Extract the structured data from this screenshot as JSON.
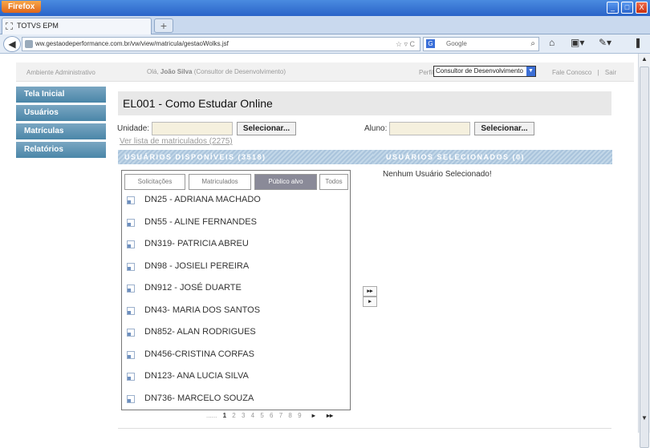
{
  "browser": {
    "menu_button": "Firefox",
    "tab_title": "TOTVS EPM",
    "new_tab": "+",
    "url": "ww.gestaodeperformance.com.br/vw/view/matricula/gestaoWolks.jsf",
    "search_engine": "G",
    "search_placeholder": "Google",
    "window_controls": [
      "_",
      "□",
      "X"
    ]
  },
  "header": {
    "environment": "Ambiente Administrativo",
    "greeting_prefix": "Olá, ",
    "user_name": "João Silva",
    "user_role": " (Consultor de Desenvolvimento)",
    "profile_label": "Perfil",
    "profile_value": "Consultor de Desenvolvimento",
    "contact_link": "Fale Conosco",
    "separator": "|",
    "exit_link": "Sair"
  },
  "sidebar": {
    "items": [
      {
        "label": "Tela Inicial"
      },
      {
        "label": "Usuários"
      },
      {
        "label": "Matrículas"
      },
      {
        "label": "Relatórios"
      }
    ]
  },
  "main": {
    "title": "EL001 - Como Estudar Online",
    "unit_label": "Unidade:",
    "unit_value": "",
    "select_button": "Selecionar...",
    "student_label": "Aluno:",
    "student_value": "",
    "enrollment_link": "Ver lista de matriculados (2275)",
    "available_header": "USUÁRIOS DISPONÍVEIS (3518)",
    "selected_header": "USUÁRIOS SELECIONADOS (0)",
    "no_selection": "Nenhum Usuário Selecionado!",
    "tabs": [
      {
        "label": "Solicitações"
      },
      {
        "label": "Matriculados"
      },
      {
        "label": "Público alvo"
      },
      {
        "label": "Todos"
      }
    ],
    "active_tab": "Público alvo",
    "users": [
      "DN25 - ADRIANA MACHADO",
      "DN55 - ALINE FERNANDES",
      "DN319- PATRICIA ABREU",
      "DN98 - JOSIELI PEREIRA",
      "DN912 - JOSÉ DUARTE",
      "DN43- MARIA DOS SANTOS",
      "DN852- ALAN RODRIGUES",
      "DN456-CRISTINA CORFAS",
      "DN123- ANA LUCIA SILVA",
      "DN736- MARCELO SOUZA"
    ],
    "pager": {
      "prefix": "......",
      "pages": [
        "1",
        "2",
        "3",
        "4",
        "5",
        "6",
        "7",
        "8",
        "9"
      ],
      "current": "1",
      "next": "▸",
      "last": "▸▸"
    },
    "move_all": "▸▸",
    "move_one": "▸"
  }
}
